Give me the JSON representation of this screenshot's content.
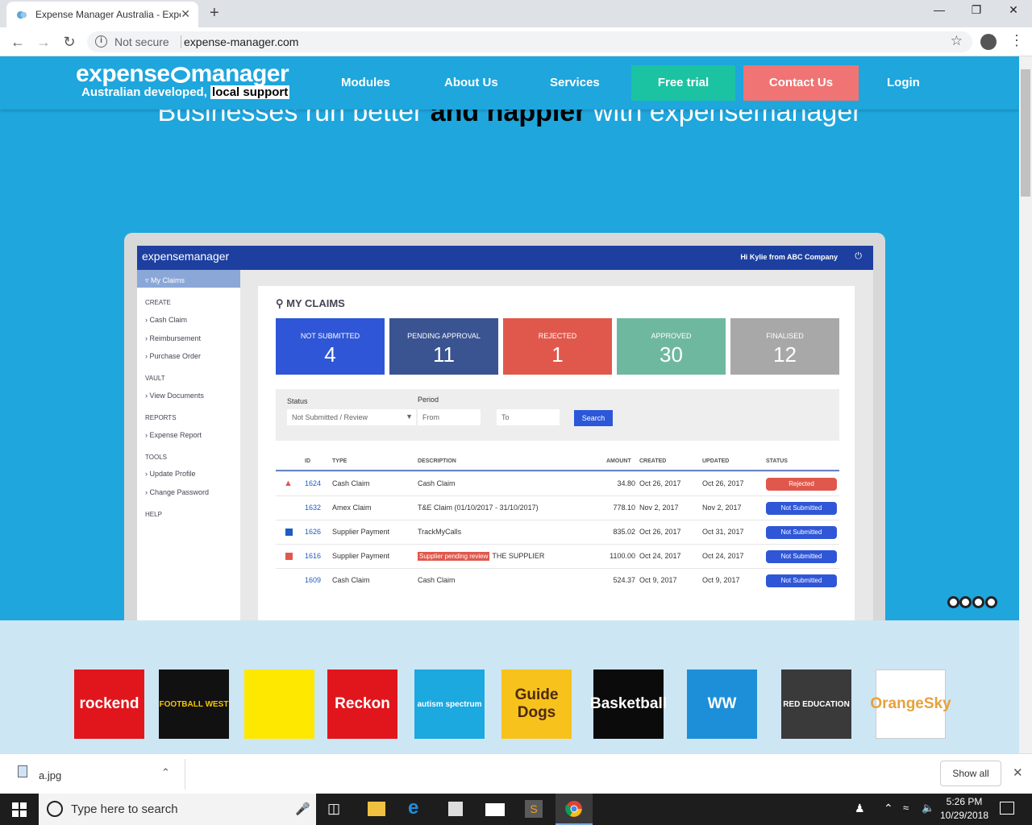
{
  "browser": {
    "tab_title": "Expense Manager Australia - Expense",
    "close_tab": "✕",
    "new_tab": "+",
    "security": "Not secure",
    "url": "expense-manager.com"
  },
  "site": {
    "logo_text": "expense",
    "logo_text2": "manager",
    "tagline_a": "Australian developed,",
    "tagline_b": "local support",
    "nav": [
      "Modules",
      "About Us",
      "Services"
    ],
    "trial": "Free trial",
    "contact": "Contact Us",
    "login": "Login",
    "hero_a": "Businesses run better ",
    "hero_b": "and happier",
    "hero_c": " with expensemanager"
  },
  "app": {
    "brand": "expensemanager",
    "greeting": "Hi Kylie from ABC Company",
    "menu": "My Claims",
    "sidebar": {
      "create": "CREATE",
      "cash": "Cash Claim",
      "reimb": "Reimbursement",
      "po": "Purchase Order",
      "vault": "VAULT",
      "docs": "View Documents",
      "reports": "REPORTS",
      "expense_report": "Expense Report",
      "tools": "TOOLS",
      "profile": "Update Profile",
      "password": "Change Password",
      "help": "HELP"
    },
    "page_title": "MY CLAIMS",
    "cards": [
      {
        "label": "NOT SUBMITTED",
        "value": "4",
        "color": "#2f56d6"
      },
      {
        "label": "PENDING APPROVAL",
        "value": "11",
        "color": "#3a5391"
      },
      {
        "label": "REJECTED",
        "value": "1",
        "color": "#e0584c"
      },
      {
        "label": "APPROVED",
        "value": "30",
        "color": "#6fb8a0"
      },
      {
        "label": "FINALISED",
        "value": "12",
        "color": "#a8a8a8"
      }
    ],
    "filters": {
      "status_label": "Status",
      "status_value": "Not Submitted / Review",
      "period_label": "Period",
      "from": "From",
      "to": "To",
      "search": "Search"
    },
    "columns": [
      "ID",
      "TYPE",
      "DESCRIPTION",
      "AMOUNT",
      "CREATED",
      "UPDATED",
      "STATUS"
    ],
    "rows": [
      {
        "id": "1624",
        "type": "Cash Claim",
        "desc": "Cash Claim",
        "tag": "",
        "amount": "34.80",
        "created": "Oct 26, 2017",
        "updated": "Oct 26, 2017",
        "status": "Rejected",
        "scolor": "#e0584c",
        "icon": "warning"
      },
      {
        "id": "1632",
        "type": "Amex Claim",
        "desc": "T&E Claim (01/10/2017 - 31/10/2017)",
        "tag": "",
        "amount": "778.10",
        "created": "Nov 2, 2017",
        "updated": "Nov 2, 2017",
        "status": "Not Submitted",
        "scolor": "#2f56d6",
        "icon": ""
      },
      {
        "id": "1626",
        "type": "Supplier Payment",
        "desc": "TrackMyCalls",
        "tag": "",
        "amount": "835.02",
        "created": "Oct 26, 2017",
        "updated": "Oct 31, 2017",
        "status": "Not Submitted",
        "scolor": "#2f56d6",
        "icon": "doc"
      },
      {
        "id": "1616",
        "type": "Supplier Payment",
        "desc": "THE SUPPLIER",
        "tag": "Supplier pending review",
        "amount": "1100.00",
        "created": "Oct 24, 2017",
        "updated": "Oct 24, 2017",
        "status": "Not Submitted",
        "scolor": "#2f56d6",
        "icon": "list"
      },
      {
        "id": "1609",
        "type": "Cash Claim",
        "desc": "Cash Claim",
        "tag": "",
        "amount": "524.37",
        "created": "Oct 9, 2017",
        "updated": "Oct 9, 2017",
        "status": "Not Submitted",
        "scolor": "#2f56d6",
        "icon": ""
      }
    ]
  },
  "clients": [
    {
      "name": "rockend",
      "bg": "#e0161c",
      "fg": "#ffffff"
    },
    {
      "name": "FOOTBALL WEST",
      "bg": "#111111",
      "fg": "#f5c400"
    },
    {
      "name": "",
      "bg": "#ffe800",
      "fg": "#000000"
    },
    {
      "name": "Reckon",
      "bg": "#e0161c",
      "fg": "#ffffff"
    },
    {
      "name": "autism spectrum",
      "bg": "#1ba9e0",
      "fg": "#ffffff"
    },
    {
      "name": "Guide Dogs",
      "bg": "#f7c21c",
      "fg": "#4b2a10"
    },
    {
      "name": "Basketball",
      "bg": "#0b0b0b",
      "fg": "#ffffff"
    },
    {
      "name": "WW",
      "bg": "#1c8fd8",
      "fg": "#ffffff"
    },
    {
      "name": "RED EDUCATION",
      "bg": "#3a3a3a",
      "fg": "#ffffff"
    },
    {
      "name": "OrangeSky",
      "bg": "#ffffff",
      "fg": "#e7a13a"
    }
  ],
  "download": {
    "file": "a.jpg",
    "show_all": "Show all"
  },
  "taskbar": {
    "search": "Type here to search",
    "time": "5:26 PM",
    "date": "10/29/2018"
  }
}
